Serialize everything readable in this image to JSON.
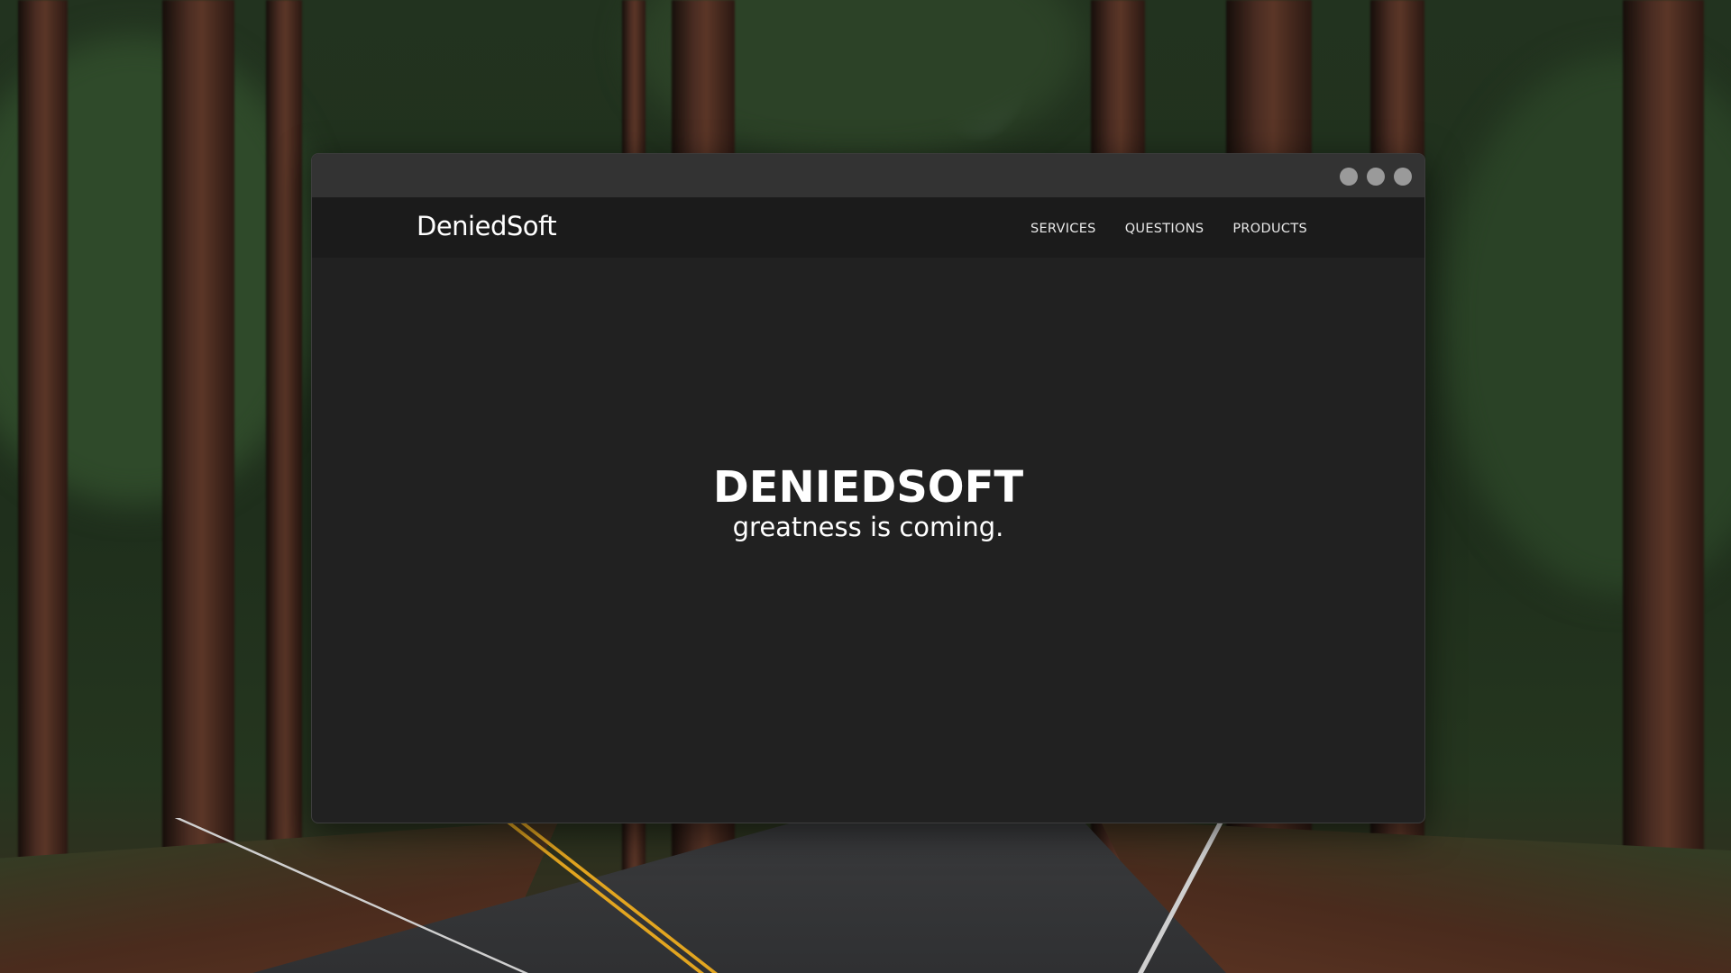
{
  "window": {
    "controls": [
      "minimize-button",
      "maximize-button",
      "close-button"
    ]
  },
  "navbar": {
    "brand": "DeniedSoft",
    "links": [
      {
        "label": "SERVICES"
      },
      {
        "label": "QUESTIONS"
      },
      {
        "label": "PRODUCTS"
      }
    ]
  },
  "hero": {
    "title": "DENIEDSOFT",
    "subtitle": "greatness is coming."
  },
  "colors": {
    "window_background": "#212121",
    "titlebar": "#333333",
    "navbar": "#1b1b1b",
    "text": "#ffffff",
    "window_dots": "#9a9a9a"
  }
}
